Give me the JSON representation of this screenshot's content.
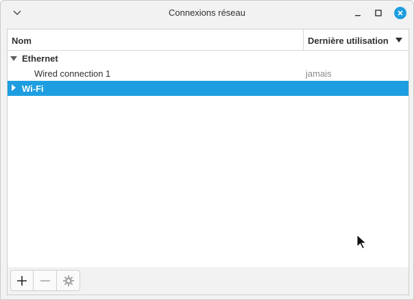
{
  "window": {
    "title": "Connexions réseau"
  },
  "table": {
    "columns": {
      "name": "Nom",
      "last_used": "Dernière utilisation"
    },
    "groups": [
      {
        "label": "Ethernet",
        "expanded": true,
        "connections": [
          {
            "name": "Wired connection 1",
            "last_used": "jamais"
          }
        ]
      },
      {
        "label": "Wi-Fi",
        "expanded": false,
        "selected": true,
        "connections": []
      }
    ]
  },
  "toolbar": {
    "add_icon": "plus-icon",
    "remove_icon": "minus-icon",
    "settings_icon": "gear-icon"
  },
  "colors": {
    "accent": "#1e9ee0",
    "selected_text": "#ffffff",
    "muted_text": "#8a8a8a"
  }
}
